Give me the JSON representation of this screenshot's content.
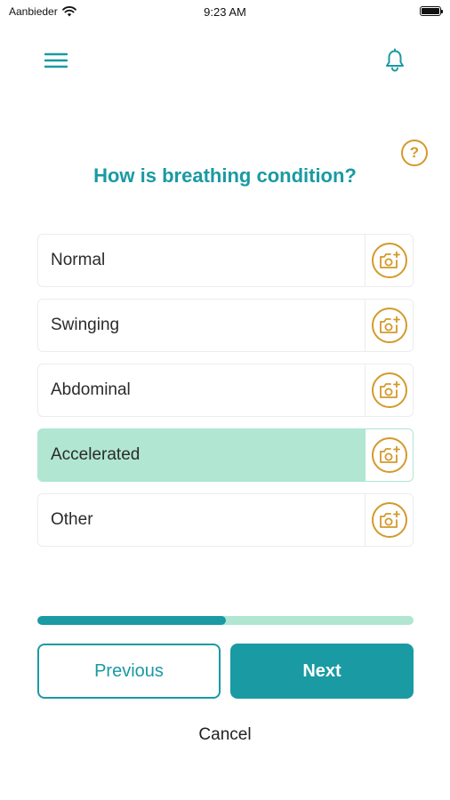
{
  "status_bar": {
    "carrier": "Aanbieder",
    "time": "9:23 AM"
  },
  "header": {
    "menu_icon": "hamburger-menu-icon",
    "bell_icon": "bell-icon",
    "help_label": "?"
  },
  "question": "How is breathing condition?",
  "options": [
    {
      "label": "Normal",
      "selected": false
    },
    {
      "label": "Swinging",
      "selected": false
    },
    {
      "label": "Abdominal",
      "selected": false
    },
    {
      "label": "Accelerated",
      "selected": true
    },
    {
      "label": "Other",
      "selected": false
    }
  ],
  "progress": {
    "value": 0.5
  },
  "buttons": {
    "previous": "Previous",
    "next": "Next",
    "cancel": "Cancel"
  },
  "colors": {
    "primary": "#1a9aa2",
    "selected_bg": "#b0e6d2",
    "accent": "#d39a2b"
  }
}
